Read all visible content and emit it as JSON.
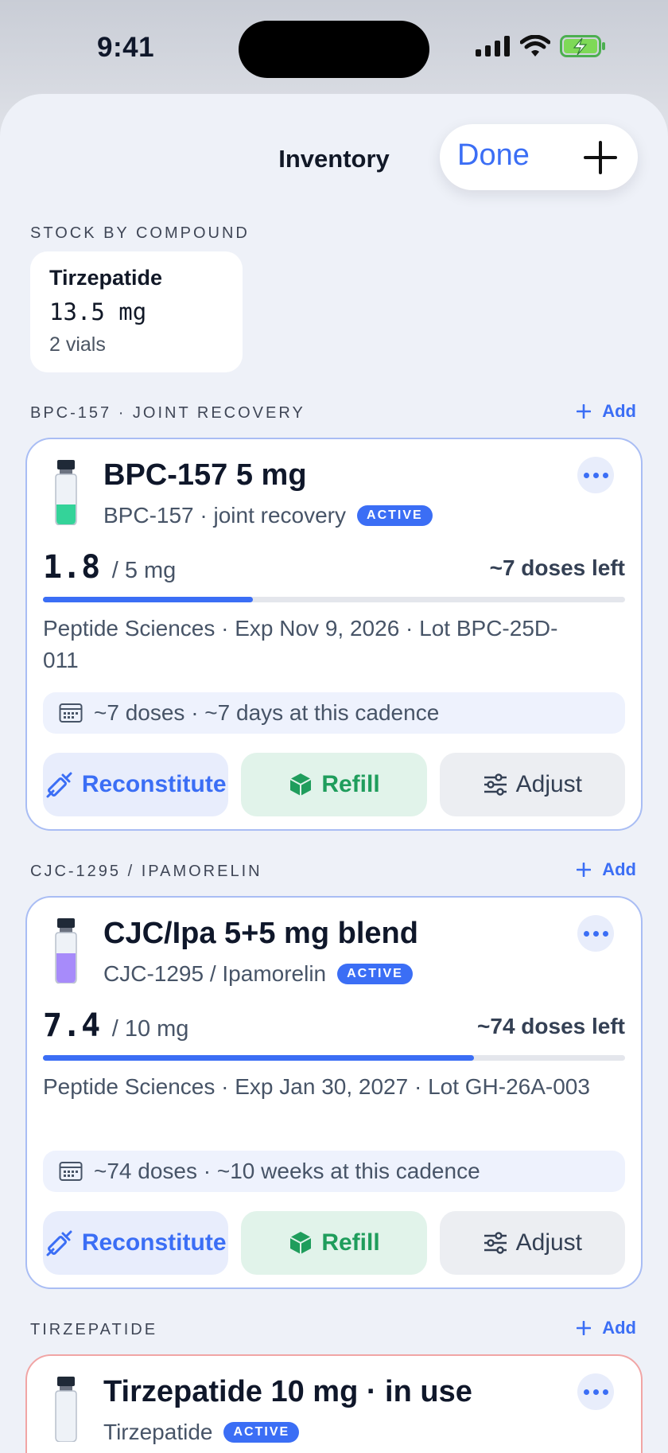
{
  "status_bar": {
    "time": "9:41"
  },
  "nav": {
    "title": "Inventory",
    "done_label": "Done"
  },
  "stock_section": {
    "label": "STOCK BY COMPOUND",
    "items": [
      {
        "name": "Tirzepatide",
        "amount": "13.5 mg",
        "vials": "2 vials"
      }
    ]
  },
  "groups": [
    {
      "label": "BPC-157 · JOINT RECOVERY",
      "add_label": "Add",
      "card": {
        "title": "BPC-157 5 mg",
        "subtitle": "BPC-157 · joint recovery",
        "badge": "ACTIVE",
        "remaining": "1.8",
        "total": "/ 5 mg",
        "remaining_fraction": 0.36,
        "doses_left": "~7 doses left",
        "meta": "Peptide Sciences · Exp Nov 9, 2026 · Lot BPC-25D-011",
        "cadence": "~7 doses · ~7 days at this cadence",
        "liquid_color": "#34d399",
        "actions": {
          "reconstitute": "Reconstitute",
          "refill": "Refill",
          "adjust": "Adjust"
        }
      }
    },
    {
      "label": "CJC-1295 / IPAMORELIN",
      "add_label": "Add",
      "card": {
        "title": "CJC/Ipa 5+5 mg blend",
        "subtitle": "CJC-1295 / Ipamorelin",
        "badge": "ACTIVE",
        "remaining": "7.4",
        "total": "/ 10 mg",
        "remaining_fraction": 0.74,
        "doses_left": "~74 doses left",
        "meta": "Peptide Sciences · Exp Jan 30, 2027 · Lot GH-26A-003",
        "cadence": "~74 doses · ~10 weeks at this cadence",
        "liquid_color": "#a78bfa",
        "actions": {
          "reconstitute": "Reconstitute",
          "refill": "Refill",
          "adjust": "Adjust"
        }
      }
    },
    {
      "label": "TIRZEPATIDE",
      "add_label": "Add",
      "card": {
        "title": "Tirzepatide 10 mg · in use",
        "subtitle": "Tirzepatide",
        "badge": "ACTIVE"
      }
    }
  ],
  "colors": {
    "accent": "#3b6ef5",
    "refill": "#1f9d5c",
    "warn_border": "#f1a5a5"
  }
}
